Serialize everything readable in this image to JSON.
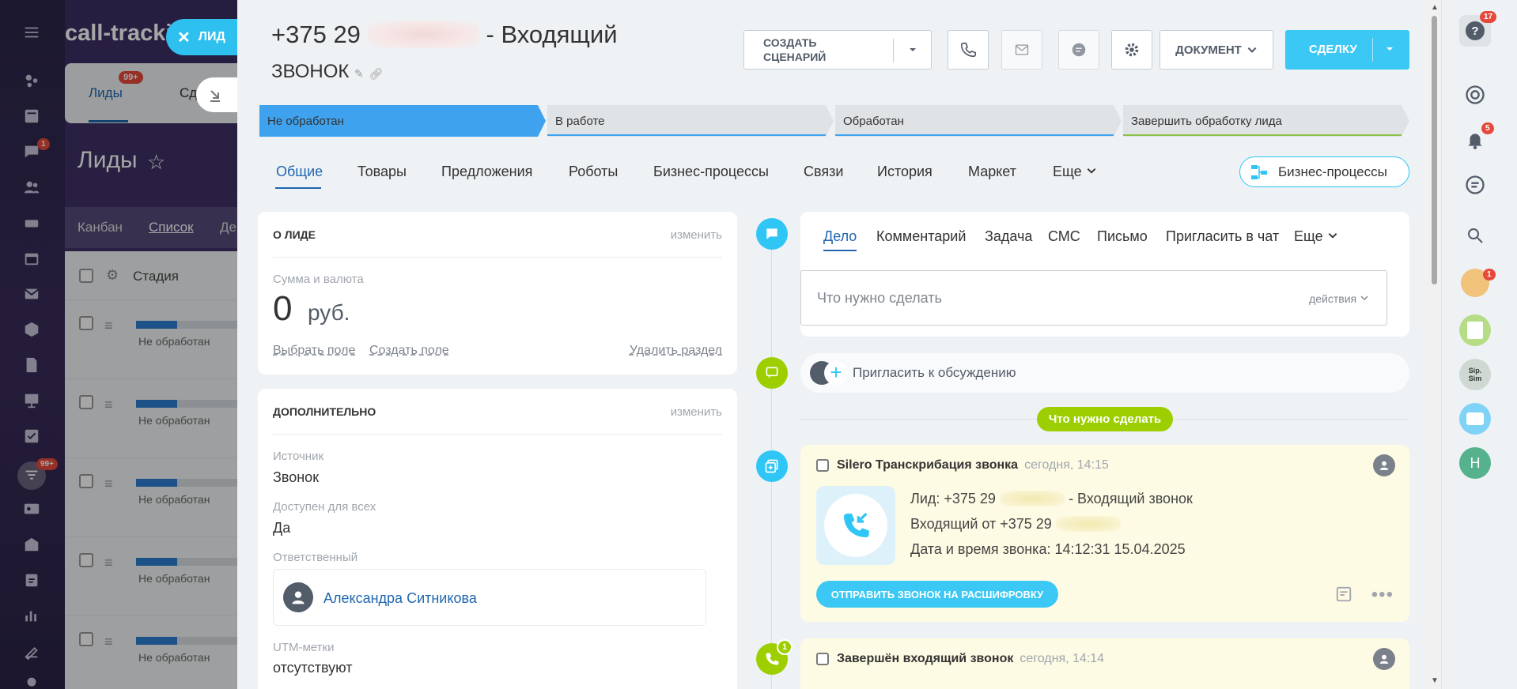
{
  "colors": {
    "accent": "#3bc8f5",
    "link": "#2067b0",
    "stage_active": "#3fa2ee",
    "todo_green": "#9dcf00",
    "badge_red": "#e6493b"
  },
  "left_sidebar": {
    "icons": [
      "menu-icon",
      "sites-icon",
      "feed-icon",
      "chat-icon",
      "contacts-icon",
      "drive-icon",
      "calendar-icon",
      "mail-icon",
      "shield-icon",
      "docs-icon",
      "board-icon",
      "tasks-icon",
      "crm-funnel-icon",
      "id-card-icon",
      "bank-icon",
      "planner-icon",
      "analytics-icon",
      "sign-icon",
      "robot-icon"
    ],
    "chat_badge": "1",
    "crm_badge": "99+"
  },
  "bg_page": {
    "logo": "call-tracki",
    "tab_leads": "Лиды",
    "tab_leads_badge": "99+",
    "tab_deals": "Сд",
    "page_title": "Лиды",
    "view_kanban": "Канбан",
    "view_list": "Список",
    "view_more": "Де",
    "col_stage": "Стадия",
    "rows": [
      {
        "stage": "Не обработан"
      },
      {
        "stage": "Не обработан"
      },
      {
        "stage": "Не обработан"
      },
      {
        "stage": "Не обработан"
      },
      {
        "stage": "Не обработан"
      }
    ]
  },
  "close_tab": {
    "label": "ЛИД"
  },
  "header": {
    "phone_prefix": "+375 29",
    "phone_hidden": "133-45-14",
    "title_suffix": "- Входящий",
    "title_line2": "ЗВОНОК",
    "scenario_btn_line1": "СОЗДАТЬ",
    "scenario_btn_line2": "СЦЕНАРИЙ",
    "doc_btn": "ДОКУМЕНТ",
    "deal_btn": "СДЕЛКУ"
  },
  "stages": [
    {
      "label": "Не обработан",
      "active": true
    },
    {
      "label": "В работе"
    },
    {
      "label": "Обработан"
    },
    {
      "label": "Завершить обработку лида"
    }
  ],
  "tabs": [
    "Общие",
    "Товары",
    "Предложения",
    "Роботы",
    "Бизнес-процессы",
    "Связи",
    "История",
    "Маркет",
    "Еще"
  ],
  "bp_button": "Бизнес-процессы",
  "about": {
    "title": "О ЛИДЕ",
    "edit": "изменить",
    "sum_label": "Сумма и валюта",
    "sum_value": "0",
    "currency": "руб.",
    "choose_field": "Выбрать поле",
    "create_field": "Создать поле",
    "delete_section": "Удалить раздел"
  },
  "extra": {
    "title": "ДОПОЛНИТЕЛЬНО",
    "edit": "изменить",
    "source_label": "Источник",
    "source_value": "Звонок",
    "public_label": "Доступен для всех",
    "public_value": "Да",
    "responsible_label": "Ответственный",
    "responsible_value": "Александра Ситникова",
    "utm_label": "UTM-метки",
    "utm_value": "отсутствуют"
  },
  "activity": {
    "tabs": [
      "Дело",
      "Комментарий",
      "Задача",
      "СМС",
      "Письмо",
      "Пригласить в чат",
      "Еще"
    ],
    "placeholder": "Что нужно сделать",
    "actions": "действия",
    "invite": "Пригласить к обсуждению",
    "todo_pill": "Что нужно сделать"
  },
  "timeline": {
    "item1": {
      "title": "Silero Транскрибация звонка",
      "time": "сегодня, 14:15",
      "line1_prefix": "Лид: +375 29",
      "line1_hidden": "133-45-14",
      "line1_suffix": "- Входящий звонок",
      "line2_prefix": "Входящий от +375 29",
      "line2_hidden": "133-45-14",
      "line3": "Дата и время звонка: 14:12:31 15.04.2025",
      "button": "ОТПРАВИТЬ ЗВОНОК НА РАСШИФРОВКУ"
    },
    "item2": {
      "title": "Завершён входящий звонок",
      "time": "сегодня, 14:14",
      "badge": "1"
    }
  },
  "right_sidebar": {
    "help_badge": "17",
    "notify_badge": "5",
    "avatar_badge": "1",
    "sip_label": "Sip.\nSim",
    "user_initial": "Н"
  }
}
